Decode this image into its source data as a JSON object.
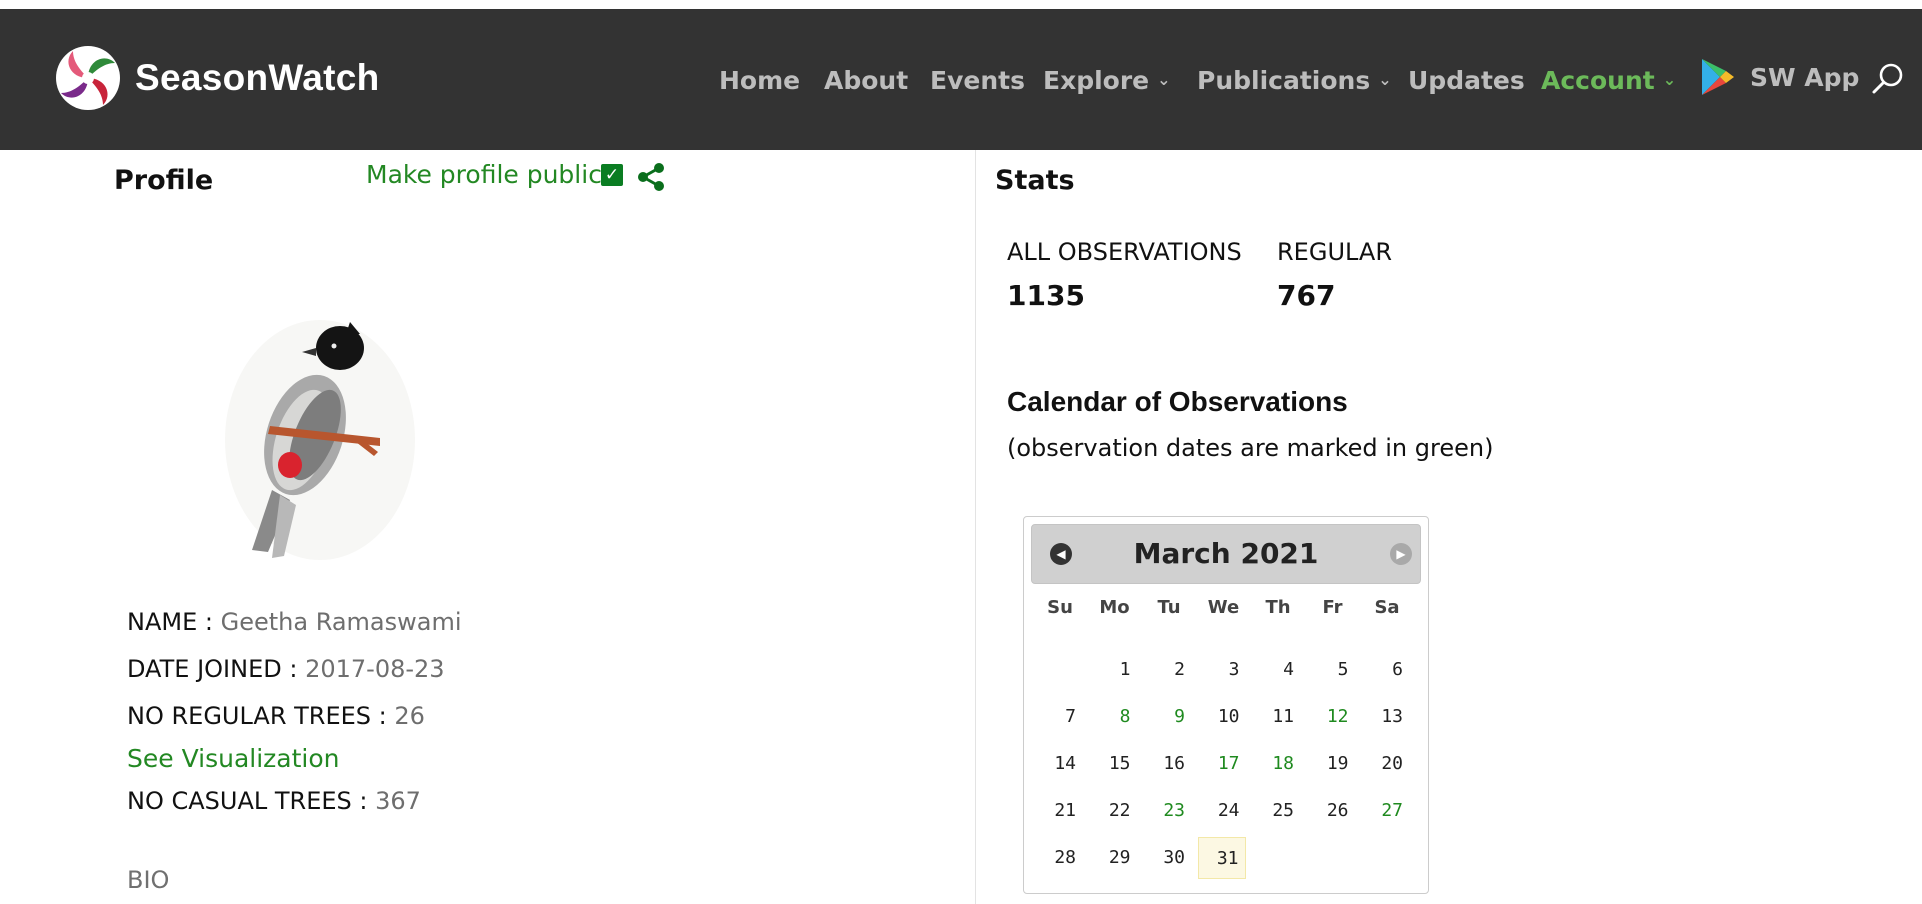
{
  "nav": {
    "brand": "SeasonWatch",
    "items": [
      {
        "label": "Home",
        "dropdown": false,
        "active": false
      },
      {
        "label": "About",
        "dropdown": false,
        "active": false
      },
      {
        "label": "Events",
        "dropdown": false,
        "active": false
      },
      {
        "label": "Explore",
        "dropdown": true,
        "active": false
      },
      {
        "label": "Publications",
        "dropdown": true,
        "active": false
      },
      {
        "label": "Updates",
        "dropdown": false,
        "active": false
      },
      {
        "label": "Account",
        "dropdown": true,
        "active": true
      }
    ],
    "app_label": "SW App",
    "chevron": "⌄"
  },
  "profile": {
    "title": "Profile",
    "make_public_label": "Make profile public",
    "make_public_checked": true,
    "check_glyph": "✓",
    "fields": [
      {
        "label": "NAME :",
        "value": "Geetha Ramaswami"
      },
      {
        "label": "DATE JOINED :",
        "value": "2017-08-23"
      },
      {
        "label": "NO REGULAR TREES :",
        "value": "26"
      }
    ],
    "visualization_link": "See Visualization",
    "casual_field": {
      "label": "NO CASUAL TREES :",
      "value": "367"
    },
    "bio_label": "BIO"
  },
  "stats": {
    "title": "Stats",
    "all_label": "ALL OBSERVATIONS",
    "all_value": "1135",
    "regular_label": "REGULAR",
    "regular_value": "767"
  },
  "calendar": {
    "heading": "Calendar of Observations",
    "subheading": "(observation dates are marked in green)",
    "month_label": "March 2021",
    "prev_glyph": "◀",
    "next_glyph": "▶",
    "weekdays": [
      "Su",
      "Mo",
      "Tu",
      "We",
      "Th",
      "Fr",
      "Sa"
    ],
    "first_weekday": 1,
    "days_in_month": 31,
    "observed_days": [
      8,
      9,
      12,
      17,
      18,
      23,
      27
    ],
    "highlighted_day": 31
  },
  "colors": {
    "navbar_bg": "#333333",
    "accent_green": "#238823",
    "active_nav": "#6cba5a"
  }
}
